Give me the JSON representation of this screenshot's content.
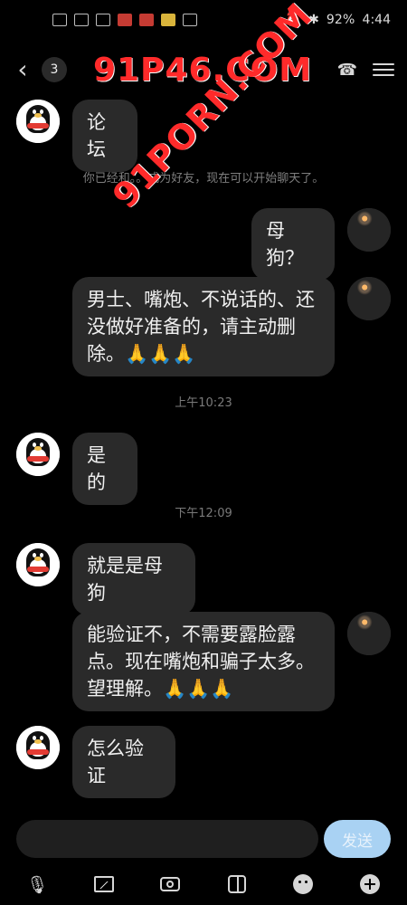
{
  "status_bar": {
    "battery": "92%",
    "time": "4:44",
    "left_icons": [
      "hd-icon",
      "signal-icon",
      "wifi-icon",
      "app-icon",
      "app-icon",
      "app-icon",
      "more-icon"
    ]
  },
  "top_bar": {
    "back_icon": "chevron-left-icon",
    "unread_count": "3",
    "watermark_text": "91P46.COM",
    "phone_icon": "phone-icon",
    "menu_icon": "menu-icon"
  },
  "watermark": {
    "diagonal_text": "91PORN.COM"
  },
  "chat": {
    "system_message": "你已经和。。成为好友，现在可以开始聊天了。",
    "time_1": "上午10:23",
    "time_2": "下午12:09",
    "messages": [
      {
        "side": "left",
        "text": "论坛"
      },
      {
        "side": "right",
        "text": "母狗？"
      },
      {
        "side": "right",
        "text": "男士、嘴炮、不说话的、还没做好准备的，请主动删除。🙏🙏🙏"
      },
      {
        "side": "left",
        "text": "是的"
      },
      {
        "side": "left",
        "text": "就是是母狗"
      },
      {
        "side": "right",
        "text": "能验证不，不需要露脸露点。现在嘴炮和骗子太多。望理解。🙏🙏🙏"
      },
      {
        "side": "left",
        "text": "怎么验证"
      }
    ]
  },
  "composer": {
    "send_label": "发送"
  }
}
